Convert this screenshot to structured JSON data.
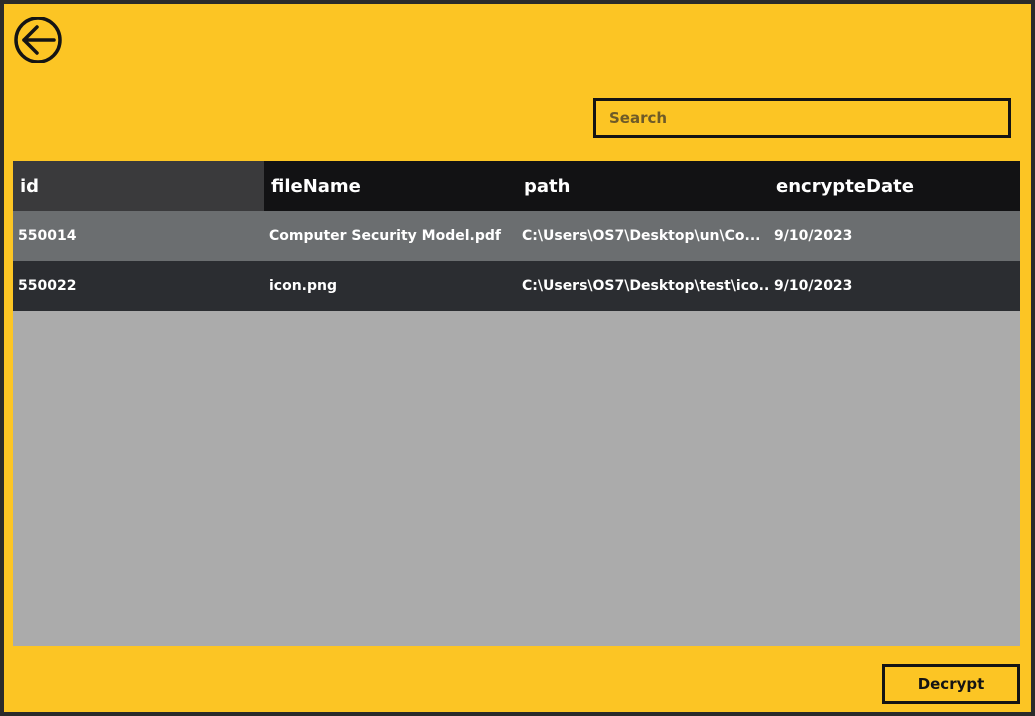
{
  "colors": {
    "background": "#fcc524",
    "header_bg": "#121214",
    "row_alt": "#6b6e70",
    "row_dark": "#2b2d31",
    "grid_bg": "#ababab",
    "border": "#141414"
  },
  "toolbar": {
    "back_icon": "arrow-left-circle-icon"
  },
  "search": {
    "placeholder": "Search",
    "value": ""
  },
  "table": {
    "columns": [
      "id",
      "fileName",
      "path",
      "encrypteDate"
    ],
    "rows": [
      {
        "id": "550014",
        "fileName": "Computer Security Model.pdf",
        "path": "C:\\Users\\OS7\\Desktop\\un\\Co...",
        "date": "9/10/2023"
      },
      {
        "id": "550022",
        "fileName": "icon.png",
        "path": "C:\\Users\\OS7\\Desktop\\test\\ico...",
        "date": "9/10/2023"
      }
    ]
  },
  "actions": {
    "decrypt_label": "Decrypt"
  }
}
